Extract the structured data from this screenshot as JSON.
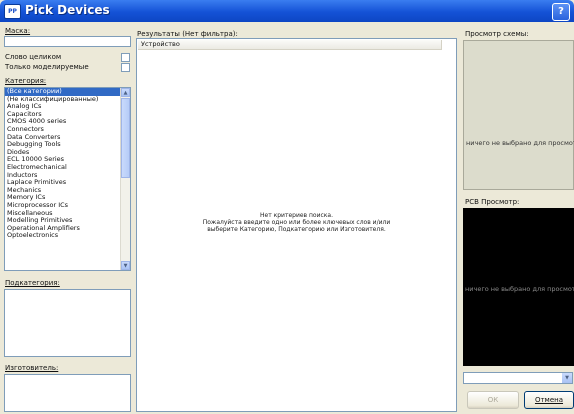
{
  "window": {
    "title": "Pick Devices",
    "app_icon_text": "PP",
    "help_label": "?"
  },
  "left": {
    "mask_label": "Маска:",
    "mask_value": "",
    "whole_words_label": "Слово целиком",
    "only_models_label": "Только моделируемые",
    "categories_label": "Категория:",
    "categories": [
      "(Все категории)",
      "(Не классифицированные)",
      "Analog ICs",
      "Capacitors",
      "CMOS 4000 series",
      "Connectors",
      "Data Converters",
      "Debugging Tools",
      "Diodes",
      "ECL 10000 Series",
      "Electromechanical",
      "Inductors",
      "Laplace Primitives",
      "Mechanics",
      "Memory ICs",
      "Microprocessor ICs",
      "Miscellaneous",
      "Modelling Primitives",
      "Operational Amplifiers",
      "Optoelectronics"
    ],
    "selected_category_index": 0,
    "subcategory_label": "Подкатегория:",
    "manufacturer_label": "Изготовитель:"
  },
  "results": {
    "header": "Результаты (Нет фильтра):",
    "column_device": "Устройство",
    "empty_line1": "Нет критериев поиска.",
    "empty_line2": "Пожалуйста введите одно или более ключевых слов и/или",
    "empty_line3": "выберите Категорию, Подкатегорию или Изготовителя."
  },
  "preview": {
    "schematic_label": "Просмотр схемы:",
    "schematic_empty": "ничего не выбрано для просмотра",
    "pcb_label": "PCB Просмотр:",
    "pcb_empty": "ничего не выбрано для просмотра",
    "schematic_bg": "#dcdccc",
    "pcb_bg": "#000000"
  },
  "buttons": {
    "ok": "ОК",
    "cancel": "Отмена"
  }
}
